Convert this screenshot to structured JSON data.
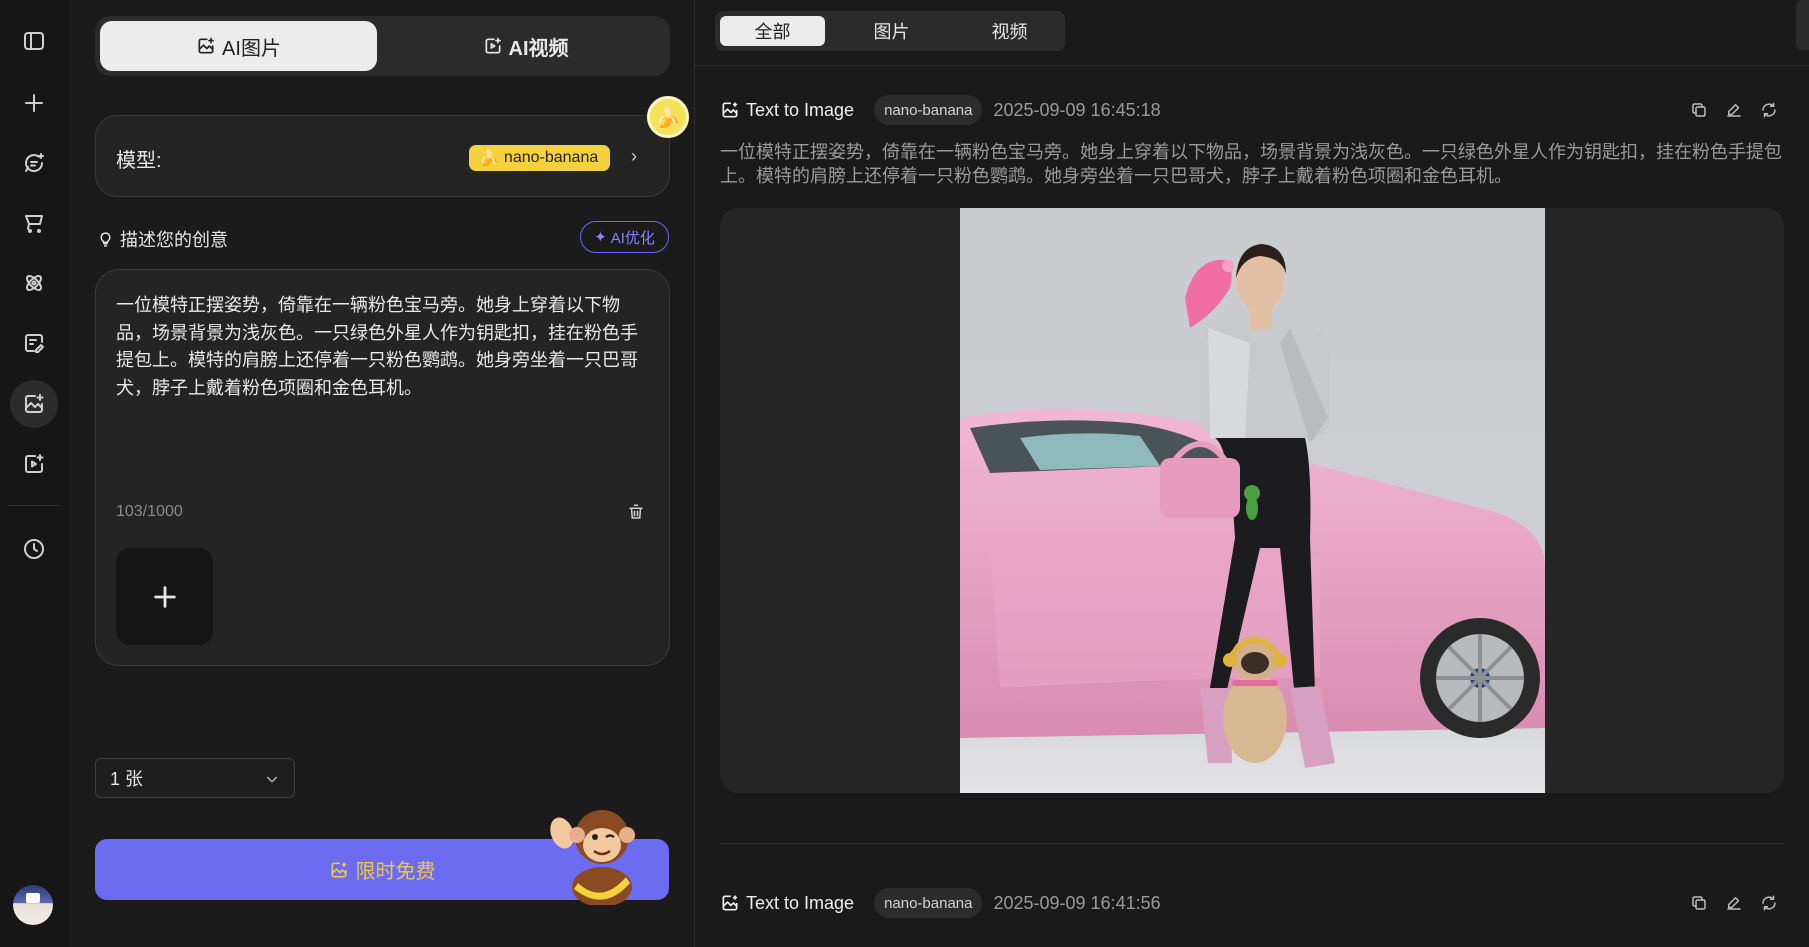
{
  "mode_tabs": [
    {
      "label": "AI图片",
      "active": true
    },
    {
      "label": "AI视频",
      "active": false
    }
  ],
  "model": {
    "label": "模型:",
    "value": "nano-banana"
  },
  "describe": {
    "label": "描述您的创意",
    "ai_optimize": "AI优化"
  },
  "prompt": {
    "text": "一位模特正摆姿势，倚靠在一辆粉色宝马旁。她身上穿着以下物品，场景背景为浅灰色。一只绿色外星人作为钥匙扣，挂在粉色手提包上。模特的肩膀上还停着一只粉色鹦鹉。她身旁坐着一只巴哥犬，脖子上戴着粉色项圈和金色耳机。",
    "counter": "103/1000"
  },
  "count_select": {
    "value": "1 张"
  },
  "generate_button": {
    "label": "限时免费"
  },
  "filter_tabs": [
    {
      "label": "全部",
      "active": true
    },
    {
      "label": "图片",
      "active": false
    },
    {
      "label": "视频",
      "active": false
    }
  ],
  "entries": [
    {
      "type": "Text to Image",
      "model": "nano-banana",
      "time": "2025-09-09 16:45:18",
      "prompt": "一位模特正摆姿势，倚靠在一辆粉色宝马旁。她身上穿着以下物品，场景背景为浅灰色。一只绿色外星人作为钥匙扣，挂在粉色手提包上。模特的肩膀上还停着一只粉色鹦鹉。她身旁坐着一只巴哥犬，脖子上戴着粉色项圈和金色耳机。"
    },
    {
      "type": "Text to Image",
      "model": "nano-banana",
      "time": "2025-09-09 16:41:56"
    }
  ],
  "icons": {
    "rail": [
      "sidebar-toggle-icon",
      "plus-icon",
      "chat-icon",
      "cart-icon",
      "atom-icon",
      "edit-doc-icon",
      "image-gen-icon",
      "video-gen-icon",
      "history-icon"
    ]
  },
  "colors": {
    "accent": "#6c6cf0",
    "banana": "#f5d23d",
    "ai_opt": "#8a82ff"
  }
}
